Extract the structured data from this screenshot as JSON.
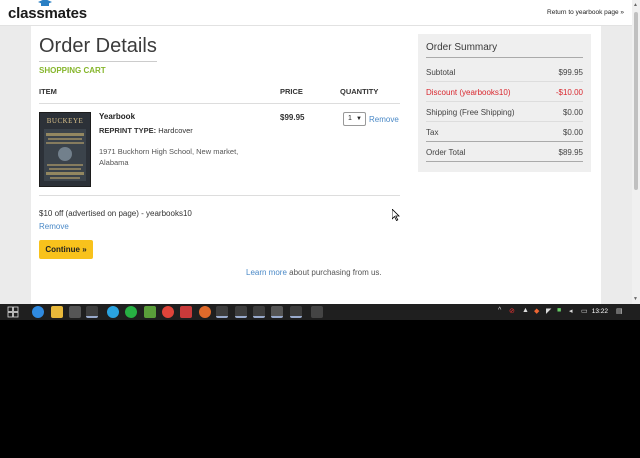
{
  "header": {
    "logo_text": "classmates",
    "return_link": "Return to yearbook page »"
  },
  "order": {
    "title": "Order Details",
    "cart_label": "SHOPPING CART",
    "columns": {
      "item": "ITEM",
      "price": "PRICE",
      "quantity": "QUANTITY"
    },
    "item": {
      "cover_title": "BUCKEYE",
      "name": "Yearbook",
      "type_label": "REPRINT TYPE:",
      "type_value": "Hardcover",
      "school": "1971 Buckhorn High School, New market, Alabama",
      "price": "$99.95",
      "quantity": "1",
      "remove_label": "Remove"
    },
    "discount_text": "$10 off (advertised on page) - yearbooks10",
    "discount_remove": "Remove",
    "continue_label": "Continue »",
    "learn_more_link": "Learn more",
    "learn_more_rest": " about purchasing from us."
  },
  "summary": {
    "title": "Order Summary",
    "rows": [
      {
        "label": "Subtotal",
        "value": "$99.95"
      },
      {
        "label": "Discount (yearbooks10)",
        "value": "-$10.00"
      },
      {
        "label": "Shipping (Free Shipping)",
        "value": "$0.00"
      },
      {
        "label": "Tax",
        "value": "$0.00"
      },
      {
        "label": "Order Total",
        "value": "$89.95"
      }
    ]
  },
  "taskbar": {
    "clock": "13:22",
    "icons": [
      "windows-start-icon",
      "edge-icon",
      "file-explorer-icon",
      "calculator-icon",
      "brave-icon",
      "telegram-icon",
      "whatsapp-icon",
      "green-app-icon",
      "chrome-icon",
      "app-red-icon",
      "firefox-icon",
      "pdf-icon",
      "app-icon",
      "app-icon",
      "app-icon",
      "app-icon",
      "app-icon",
      "app-icon"
    ]
  },
  "colors": {
    "accent_green": "#86b62c",
    "link_blue": "#4a89c7",
    "discount_red": "#d9282f",
    "button_yellow": "#f8c21c"
  }
}
